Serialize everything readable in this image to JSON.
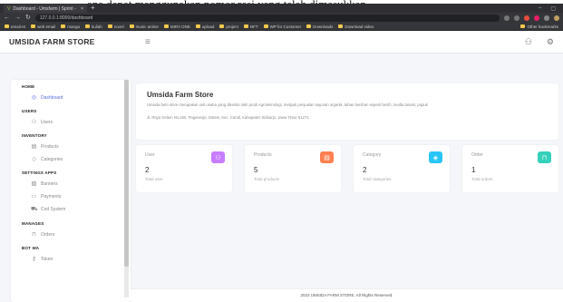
{
  "document_text": "ana dapat menggunakan nomor resi yang telah dimasukkan",
  "browser": {
    "tab_title": "Dashboard - Umsfarm | Sprint -",
    "url": "127.0.0.1:8000/dashboard",
    "bookmarks": [
      "email-et",
      "web email",
      "manga",
      "kuliah",
      "novel",
      "music anime",
      "MIRA ONE",
      "upload",
      "project",
      "NFT",
      "WP for Customer",
      "Downloads",
      "Download video",
      "Other bookmarks"
    ]
  },
  "app": {
    "brand": "UMSIDA FARM STORE",
    "header_icons": [
      "user-icon",
      "gear-icon"
    ]
  },
  "sidebar": {
    "sections": [
      {
        "title": "HOME",
        "items": [
          {
            "label": "Dashboard",
            "icon": "dashboard-icon",
            "active": true
          }
        ]
      },
      {
        "title": "USERS",
        "items": [
          {
            "label": "Users",
            "icon": "users-icon"
          }
        ]
      },
      {
        "title": "INVENTORY",
        "items": [
          {
            "label": "Products",
            "icon": "box-icon"
          },
          {
            "label": "Categories",
            "icon": "tag-icon"
          }
        ]
      },
      {
        "title": "SETTINGS APPS",
        "items": [
          {
            "label": "Banners",
            "icon": "image-icon"
          },
          {
            "label": "Payments",
            "icon": "card-icon"
          },
          {
            "label": "Cod System",
            "icon": "truck-icon"
          }
        ]
      },
      {
        "title": "MANAGES",
        "items": [
          {
            "label": "Orders",
            "icon": "cart-icon"
          }
        ]
      },
      {
        "title": "BOT WA",
        "items": [
          {
            "label": "Token",
            "icon": "key-icon"
          }
        ]
      }
    ]
  },
  "welcome": {
    "title": "Umsida Farm Store",
    "description": "Umsida farm store merupakan unit usaha yang dikelola oleh prodi Agroteknologi, meliputi penjualan sayuran organik, tahan benihan seperti benih, media tanam, pupuk",
    "address": "Jl. Raya Gelam No.250, Pagerwojo, Gelam, Kec. Candi, Kabupaten Sidoarjo, Jawa Timur 61271"
  },
  "stats": [
    {
      "label": "User",
      "value": "2",
      "note": "Total user",
      "icon": "user-icon",
      "color": "#c77dff"
    },
    {
      "label": "Products",
      "value": "5",
      "note": "Total products",
      "icon": "box-icon",
      "color": "#ff7f50"
    },
    {
      "label": "Category",
      "value": "2",
      "note": "Total categories",
      "icon": "tag-icon",
      "color": "#29c5f6"
    },
    {
      "label": "Order",
      "value": "1",
      "note": "Total orders",
      "icon": "cart-icon",
      "color": "#35d0ba"
    }
  ],
  "footer": "2023 UMSIDA FARM STORE. All Rights Reserved."
}
